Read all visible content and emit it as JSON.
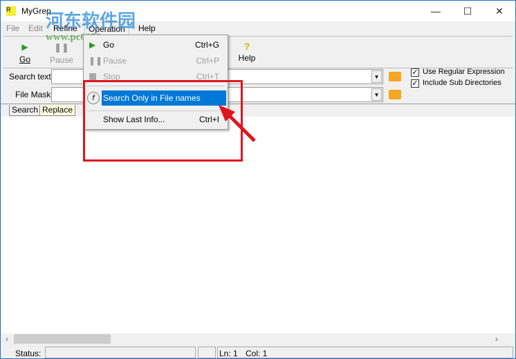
{
  "window": {
    "title": "MyGrep",
    "minimize": "—",
    "maximize": "☐",
    "close": "✕"
  },
  "watermark": {
    "text": "河东软件园",
    "url": "www.pc0359.cn"
  },
  "menubar": [
    "File",
    "Edit",
    "Refine",
    "Operation",
    "Help"
  ],
  "toolbar": {
    "go": "Go",
    "pause": "Pause",
    "help": "Help",
    "help_icon": "?"
  },
  "search": {
    "search_label": "Search text:",
    "search_value": "",
    "mask_label": "File Mask:",
    "mask_value": "",
    "use_regex": "Use Regular Expression",
    "include_sub": "Include Sub Directories",
    "use_regex_checked": true,
    "include_sub_checked": true
  },
  "tabs": [
    "Search",
    "Replace"
  ],
  "operation_menu": [
    {
      "label": "Go",
      "shortcut": "Ctrl+G",
      "disabled": false
    },
    {
      "label": "Pause",
      "shortcut": "Ctrl+P",
      "disabled": true
    },
    {
      "label": "Stop",
      "shortcut": "Ctrl+T",
      "disabled": true
    },
    {
      "label": "Search Only in File names",
      "shortcut": "",
      "highlighted": true
    },
    {
      "label": "Show Last Info...",
      "shortcut": "Ctrl+I"
    }
  ],
  "statusbar": {
    "status_label": "Status:",
    "status_value": "",
    "ln": "Ln: 1",
    "col": "Col: 1"
  },
  "colors": {
    "highlight": "#0078d7",
    "annotation": "#e0141e"
  }
}
